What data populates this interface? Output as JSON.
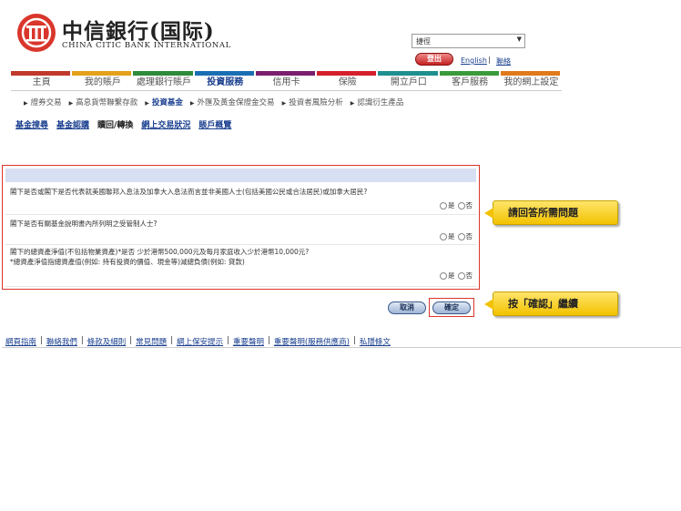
{
  "brand": {
    "name_cn": "中信銀行(国际)",
    "name_en": "CHINA CITIC BANK INTERNATIONAL",
    "accent_red": "#d9362c"
  },
  "header": {
    "quick_select_value": "捷徑",
    "logout_label": "登出",
    "lang_label": "English",
    "separator": "|",
    "contact_label": "聯絡"
  },
  "nav": {
    "bar_colors": [
      "#c0392b",
      "#e3a21a",
      "#2e8b3a",
      "#1a6fb3",
      "#7a1f6e",
      "#d4202b",
      "#1f8f8f",
      "#3a9a3a",
      "#e07a1a"
    ],
    "items": [
      {
        "label": "主頁"
      },
      {
        "label": "我的賬戶"
      },
      {
        "label": "處理銀行賬戶"
      },
      {
        "label": "投資服務"
      },
      {
        "label": "信用卡"
      },
      {
        "label": "保險"
      },
      {
        "label": "開立戶口"
      },
      {
        "label": "客戶服務"
      },
      {
        "label": "我的網上設定"
      }
    ]
  },
  "subnav": {
    "items": [
      {
        "label": "證券交易"
      },
      {
        "label": "高息貨幣聯繫存款"
      },
      {
        "label": "投資基金"
      },
      {
        "label": "外匯及黃金保證金交易"
      },
      {
        "label": "投資者風險分析"
      },
      {
        "label": "認識衍生產品"
      }
    ]
  },
  "tabs": [
    {
      "label": "基金搜尋"
    },
    {
      "label": "基金認購"
    },
    {
      "label": "贖回/轉換"
    },
    {
      "label": "網上交易狀況"
    },
    {
      "label": "賬戶概覽"
    }
  ],
  "form": {
    "yes_label": "是",
    "no_label": "否",
    "questions": [
      {
        "line1": "閣下是否或閣下是否代表就美國聯邦入息法及加拿大入息法而言並非美國人士(包括美國公民或合法居民)或加拿大居民?",
        "line2": ""
      },
      {
        "line1": "閣下是否有關基金說明書內所列明之受管制人士?",
        "line2": ""
      },
      {
        "line1": "閣下的總資產淨值(不包括物業資產)*是否 少於港幣500,000元及每月家庭收入少於港幣10,000元?",
        "line2": "*總資產淨值指總資產值(例如: 持有投資的價值、現金等)減總負債(例如: 貸款)"
      }
    ]
  },
  "callouts": {
    "answer": "請回答所需問題",
    "confirm": "按「確認」繼續"
  },
  "buttons": {
    "cancel": "取消",
    "confirm": "確定"
  },
  "footer": {
    "links": [
      {
        "label": "網頁指南"
      },
      {
        "label": "聯絡我們"
      },
      {
        "label": "條款及細則"
      },
      {
        "label": "常見問題"
      },
      {
        "label": "網上保安提示"
      },
      {
        "label": "重要聲明"
      },
      {
        "label": "重要聲明(服務供應商)"
      },
      {
        "label": "私隱條文"
      }
    ],
    "separator": "|"
  }
}
